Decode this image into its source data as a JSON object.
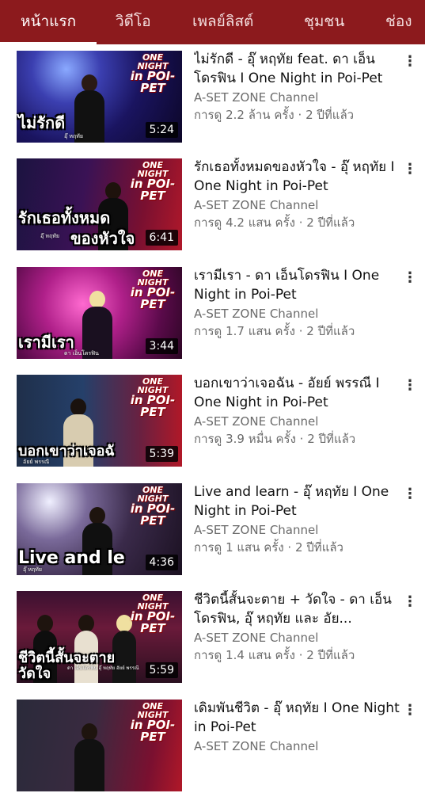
{
  "tabs": [
    "หน้าแรก",
    "วิดีโอ",
    "เพลย์ลิสต์",
    "ชุมชน",
    "ช่อง"
  ],
  "active_tab": "หน้าแรก",
  "colors": {
    "tabbar": "#8c1a1d",
    "active_tab": "#ffffff",
    "title": "#111111",
    "meta": "#6b6b6b"
  },
  "thumbnail_logo": {
    "line1": "ONE NIGHT",
    "line2": "in POI-PET"
  },
  "videos": [
    {
      "title": "ไม่รักดี - อุ๊ หฤทัย feat. ดา เอ็นโดรฟิน I One Night in Poi-Pet",
      "channel": "A-SET ZONE Channel",
      "views": "การดู 2.2 ล้าน ครั้ง",
      "age": "2 ปีที่แล้ว",
      "duration": "5:24",
      "overlay": "ไม่รักดี",
      "overlay2": "",
      "caption": "อุ๊ หฤทัย"
    },
    {
      "title": "รักเธอทั้งหมดของหัวใจ - อุ๊ หฤทัย I One Night in Poi-Pet",
      "channel": "A-SET ZONE Channel",
      "views": "การดู 4.2 แสน ครั้ง",
      "age": "2 ปีที่แล้ว",
      "duration": "6:41",
      "overlay": "รักเธอทั้งหมด",
      "overlay2": "ของหัวใจ",
      "caption": "อุ๊ หฤทัย"
    },
    {
      "title": "เรามีเรา - ดา เอ็นโดรฟิน I One Night in Poi-Pet",
      "channel": "A-SET ZONE Channel",
      "views": "การดู 1.7 แสน ครั้ง",
      "age": "2 ปีที่แล้ว",
      "duration": "3:44",
      "overlay": "เรามีเรา",
      "overlay2": "",
      "caption": "ดา เอ็นโดรฟิน"
    },
    {
      "title": "บอกเขาว่าเจอฉัน - อัยย์ พรรณี I One Night in Poi-Pet",
      "channel": "A-SET ZONE Channel",
      "views": "การดู 3.9 หมื่น ครั้ง",
      "age": "2 ปีที่แล้ว",
      "duration": "5:39",
      "overlay": "บอกเขาว่าเจอฉั",
      "overlay2": "",
      "caption": "อัยย์ พรรณี"
    },
    {
      "title": "Live and learn - อุ๊ หฤทัย I One Night in Poi-Pet",
      "channel": "A-SET ZONE Channel",
      "views": "การดู 1 แสน ครั้ง",
      "age": "2 ปีที่แล้ว",
      "duration": "4:36",
      "overlay": "Live and le",
      "overlay2": "",
      "caption": "อุ๊ หฤทัย"
    },
    {
      "title": "ชีวิตนี้สั้นจะตาย + วัดใจ - ดา เอ็นโดรฟิน, อุ๊ หฤทัย และ อัย...",
      "channel": "A-SET ZONE Channel",
      "views": "การดู 1.4 แสน ครั้ง",
      "age": "2 ปีที่แล้ว",
      "duration": "5:59",
      "overlay": "ชีวิตนี้สั้นจะตาย",
      "overlay2": "วัดใจ",
      "caption": "ดา เอ็นโดรฟิน อุ๊ หฤทัย อัยย์ พรรณี"
    },
    {
      "title": "เดิมพันชีวิต - อุ๊ หฤทัย I One Night in Poi-Pet",
      "channel": "A-SET ZONE Channel",
      "views": "",
      "age": "",
      "duration": "",
      "overlay": "",
      "overlay2": "",
      "caption": ""
    }
  ]
}
